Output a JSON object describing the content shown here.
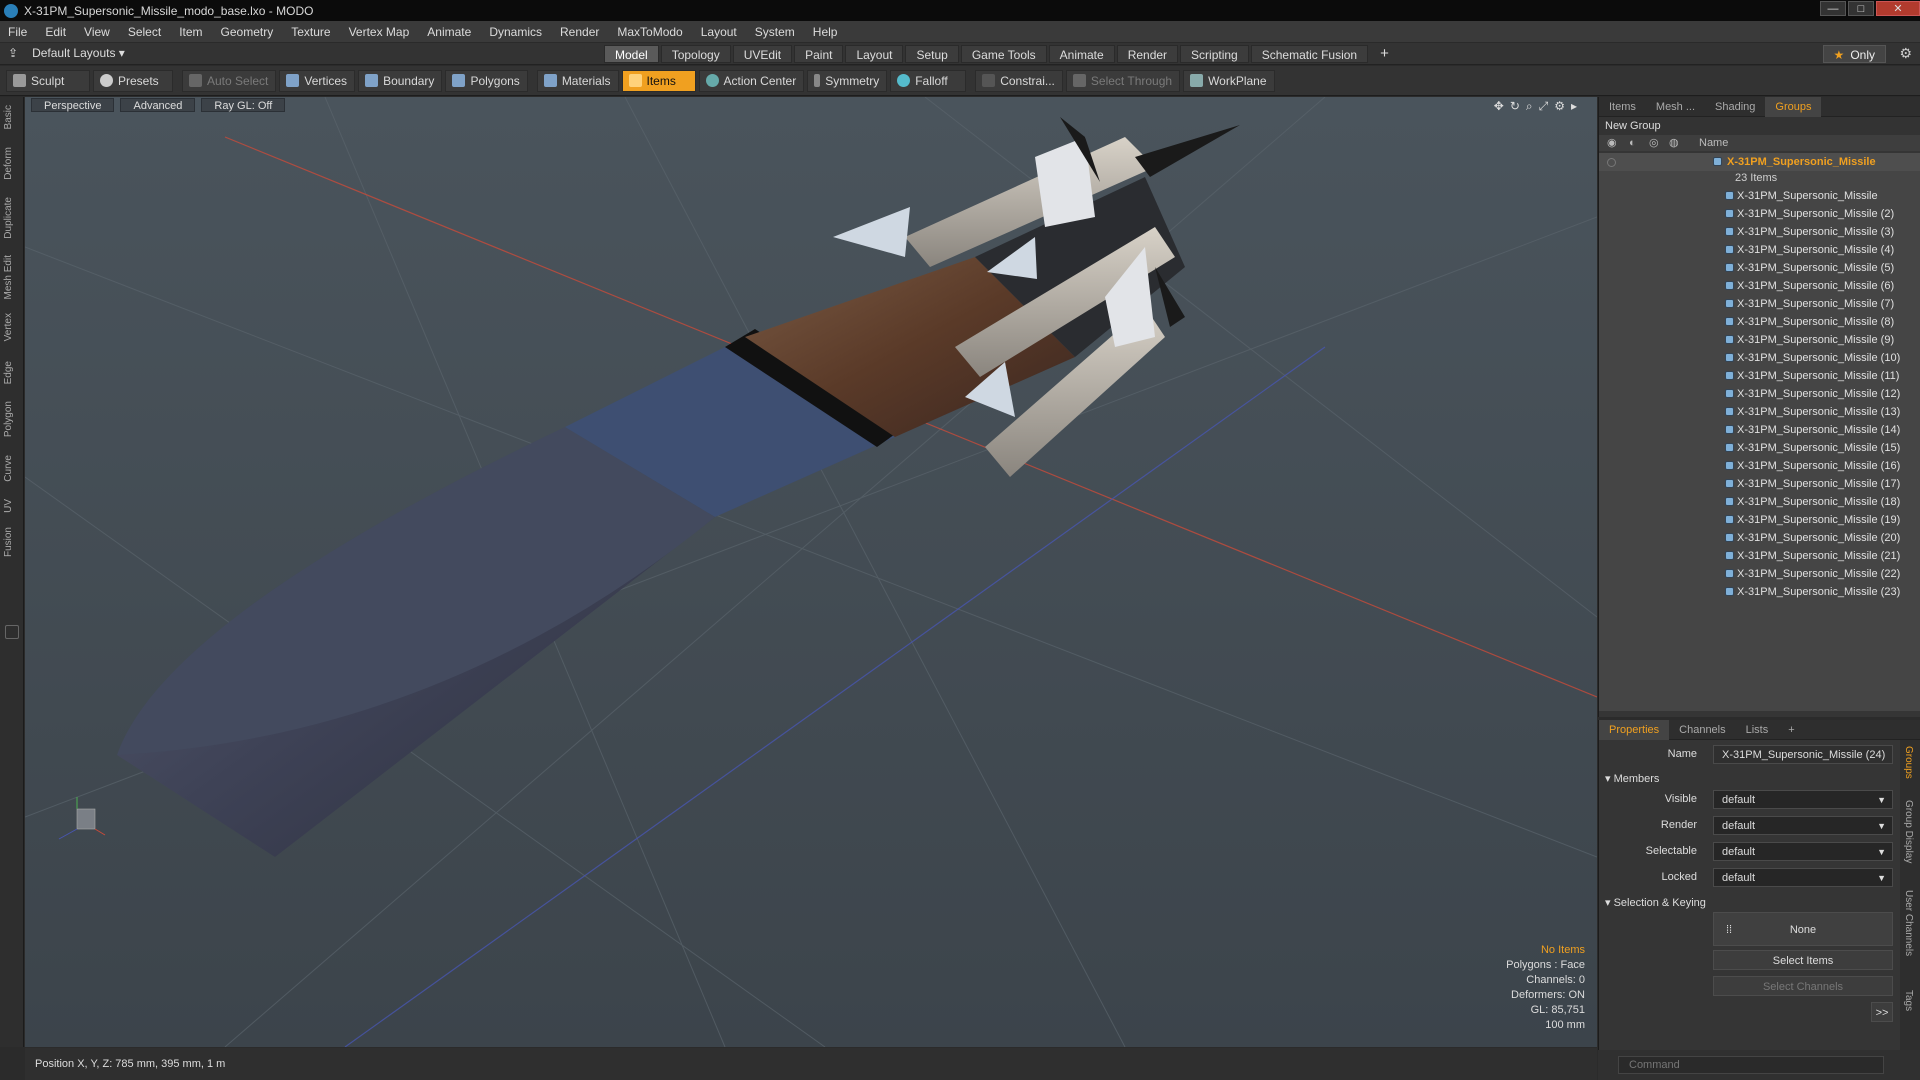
{
  "window": {
    "title": "X-31PM_Supersonic_Missile_modo_base.lxo - MODO",
    "min": "—",
    "max": "□",
    "close": "✕"
  },
  "menu": [
    "File",
    "Edit",
    "View",
    "Select",
    "Item",
    "Geometry",
    "Texture",
    "Vertex Map",
    "Animate",
    "Dynamics",
    "Render",
    "MaxToModo",
    "Layout",
    "System",
    "Help"
  ],
  "layouts": {
    "label": "Default Layouts",
    "arrow": "▾"
  },
  "tabs": [
    "Model",
    "Topology",
    "UVEdit",
    "Paint",
    "Layout",
    "Setup",
    "Game Tools",
    "Animate",
    "Render",
    "Scripting",
    "Schematic Fusion",
    "+"
  ],
  "only_label": "Only",
  "toolbar": {
    "sculpt": "Sculpt",
    "presets": "Presets",
    "auto_select": "Auto Select",
    "vertices": "Vertices",
    "boundary": "Boundary",
    "polygons": "Polygons",
    "materials": "Materials",
    "items": "Items",
    "action_center": "Action Center",
    "symmetry": "Symmetry",
    "falloff": "Falloff",
    "constraints": "Constrai...",
    "select_through": "Select Through",
    "workplane": "WorkPlane"
  },
  "left_tabs": [
    "Basic",
    "Deform",
    "Duplicate",
    "Mesh Edit",
    "Vertex",
    "Edge",
    "Polygon",
    "Curve",
    "UV",
    "Fusion"
  ],
  "viewport": {
    "view": "Perspective",
    "shading": "Advanced",
    "raygl": "Ray GL: Off",
    "info": {
      "no_items": "No Items",
      "polygons": "Polygons : Face",
      "channels": "Channels: 0",
      "deformers": "Deformers: ON",
      "gl": "GL: 85,751",
      "scale": "100 mm"
    }
  },
  "status": "Position X, Y, Z:  785 mm, 395 mm, 1 m",
  "groups_panel": {
    "tabs": [
      "Items",
      "Mesh ...",
      "Shading",
      "Groups"
    ],
    "new_group": "New Group",
    "name_col": "Name",
    "root": "X-31PM_Supersonic_Missile",
    "count": "23 Items",
    "items": [
      "X-31PM_Supersonic_Missile",
      "X-31PM_Supersonic_Missile (2)",
      "X-31PM_Supersonic_Missile (3)",
      "X-31PM_Supersonic_Missile (4)",
      "X-31PM_Supersonic_Missile (5)",
      "X-31PM_Supersonic_Missile (6)",
      "X-31PM_Supersonic_Missile (7)",
      "X-31PM_Supersonic_Missile (8)",
      "X-31PM_Supersonic_Missile (9)",
      "X-31PM_Supersonic_Missile (10)",
      "X-31PM_Supersonic_Missile (11)",
      "X-31PM_Supersonic_Missile (12)",
      "X-31PM_Supersonic_Missile (13)",
      "X-31PM_Supersonic_Missile (14)",
      "X-31PM_Supersonic_Missile (15)",
      "X-31PM_Supersonic_Missile (16)",
      "X-31PM_Supersonic_Missile (17)",
      "X-31PM_Supersonic_Missile (18)",
      "X-31PM_Supersonic_Missile (19)",
      "X-31PM_Supersonic_Missile (20)",
      "X-31PM_Supersonic_Missile (21)",
      "X-31PM_Supersonic_Missile (22)",
      "X-31PM_Supersonic_Missile (23)"
    ]
  },
  "properties": {
    "tabs": [
      "Properties",
      "Channels",
      "Lists",
      "+"
    ],
    "name_label": "Name",
    "name_value": "X-31PM_Supersonic_Missile (24)",
    "members": "Members",
    "visible_label": "Visible",
    "visible": "default",
    "render_label": "Render",
    "render": "default",
    "selectable_label": "Selectable",
    "selectable": "default",
    "locked_label": "Locked",
    "locked": "default",
    "sel_keying": "Selection & Keying",
    "none": "None",
    "select_items": "Select Items",
    "select_channels": "Select Channels",
    "more": ">>",
    "side_tabs": [
      "Groups",
      "Group Display",
      "User Channels",
      "Tags"
    ]
  },
  "command_placeholder": "Command"
}
